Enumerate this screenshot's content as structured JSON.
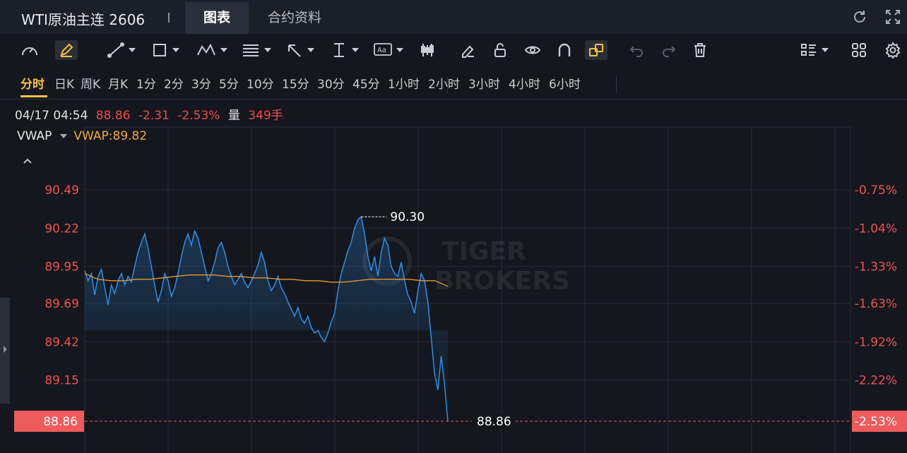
{
  "header": {
    "instrument": "WTI原油主连 2606",
    "tabs": [
      {
        "label": "图表",
        "active": true
      },
      {
        "label": "合约资料",
        "active": false
      }
    ],
    "right_icons": [
      "refresh-icon",
      "fullscreen-icon"
    ]
  },
  "toolbar": {
    "tools": [
      "gauge-icon",
      "draw-pencil-icon",
      "line-tool-icon",
      "rectangle-tool-icon",
      "pattern-tool-icon",
      "fibonacci-tool-icon",
      "arrow-tool-icon",
      "measure-tool-icon",
      "text-tool-icon",
      "candle-style-icon",
      "eraser-icon",
      "unlock-icon",
      "eye-icon",
      "magnet-icon",
      "link-icon",
      "undo-icon",
      "redo-icon",
      "trash-icon",
      "indicator-list-icon",
      "layout-grid-icon",
      "settings-icon"
    ],
    "active_tools": [
      "draw-pencil-icon",
      "link-icon"
    ],
    "text_tool_glyph": "Aa"
  },
  "intervals": [
    "分时",
    "日K",
    "周K",
    "月K",
    "1分",
    "2分",
    "3分",
    "5分",
    "10分",
    "15分",
    "30分",
    "45分",
    "1小时",
    "2小时",
    "3小时",
    "4小时",
    "6小时"
  ],
  "active_interval": "分时",
  "quote": {
    "time": "04/17 04:54",
    "price": "88.86",
    "change": "-2.31",
    "change_pct": "-2.53%",
    "volume_label": "量",
    "volume": "349手"
  },
  "indicator": {
    "name": "VWAP",
    "value_label": "VWAP:89.82"
  },
  "colors": {
    "price_line": "#2f8ee6",
    "vwap_line": "#e59a2c",
    "down": "#f04a4a",
    "accent": "#f5c242",
    "background": "#14171e"
  },
  "watermark": [
    "TIGER",
    "BROKERS"
  ],
  "chart_data": {
    "type": "line",
    "x_range": [
      "00:00",
      "05:00"
    ],
    "y_ticks": [
      90.49,
      90.22,
      89.95,
      89.69,
      89.42,
      89.15
    ],
    "y_tick_labels": [
      "90.49",
      "90.22",
      "89.95",
      "89.69",
      "89.42",
      "89.15"
    ],
    "pct_ticks": [
      "-0.75%",
      "-1.04%",
      "-1.33%",
      "-1.63%",
      "-1.92%",
      "-2.22%",
      "-2.53%"
    ],
    "ylim": [
      88.7,
      90.75
    ],
    "last_price": 88.86,
    "last_price_label": "88.86",
    "last_pct_label": "-2.53%",
    "high": 90.3,
    "high_label": "90.30",
    "low_marker_label": "88.86",
    "series": [
      {
        "name": "price",
        "values": [
          89.92,
          89.85,
          89.9,
          89.75,
          89.88,
          89.93,
          89.8,
          89.68,
          89.82,
          89.76,
          89.85,
          89.9,
          89.82,
          89.88,
          89.84,
          89.95,
          90.05,
          90.12,
          90.18,
          90.08,
          89.95,
          89.82,
          89.7,
          89.78,
          89.9,
          89.85,
          89.74,
          89.8,
          89.9,
          90.02,
          90.12,
          90.18,
          90.1,
          90.2,
          90.15,
          90.05,
          89.95,
          89.85,
          89.9,
          89.98,
          90.08,
          90.12,
          90.05,
          89.95,
          89.88,
          89.82,
          89.86,
          89.9,
          89.84,
          89.8,
          89.85,
          89.9,
          89.96,
          90.05,
          89.98,
          89.85,
          89.78,
          89.82,
          89.88,
          89.8,
          89.76,
          89.7,
          89.65,
          89.6,
          89.66,
          89.58,
          89.55,
          89.6,
          89.52,
          89.48,
          89.5,
          89.45,
          89.42,
          89.48,
          89.56,
          89.62,
          89.78,
          89.9,
          89.98,
          90.06,
          90.12,
          90.22,
          90.28,
          90.3,
          90.18,
          90.02,
          89.92,
          90.02,
          89.88,
          90.05,
          90.15,
          90.1,
          89.95,
          89.9,
          89.88,
          89.98,
          89.85,
          89.75,
          89.7,
          89.62,
          89.78,
          89.9,
          89.85,
          89.7,
          89.45,
          89.2,
          89.08,
          89.32,
          89.12,
          88.86
        ],
        "vwap": [
          89.9,
          89.86,
          89.85,
          89.85,
          89.86,
          89.86,
          89.87,
          89.88,
          89.89,
          89.89,
          89.89,
          89.88,
          89.88,
          89.87,
          89.87,
          89.86,
          89.86,
          89.85,
          89.85,
          89.84,
          89.84,
          89.85,
          89.86,
          89.86,
          89.86,
          89.86,
          89.85,
          89.85,
          89.81
        ]
      }
    ]
  }
}
